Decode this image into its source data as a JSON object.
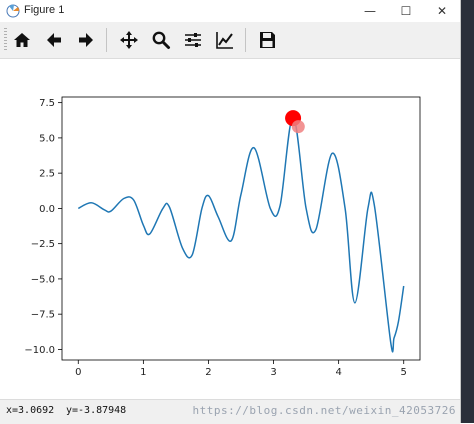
{
  "window": {
    "title": "Figure 1",
    "minimize_symbol": "—",
    "maximize_symbol": "☐",
    "close_symbol": "✕"
  },
  "toolbar": {
    "buttons": [
      {
        "name": "home-button",
        "icon": "home-icon"
      },
      {
        "name": "back-button",
        "icon": "arrow-left-icon"
      },
      {
        "name": "forward-button",
        "icon": "arrow-right-icon"
      },
      {
        "name": "pan-button",
        "icon": "move-icon"
      },
      {
        "name": "zoom-button",
        "icon": "magnifier-icon"
      },
      {
        "name": "configure-subplots-button",
        "icon": "sliders-icon"
      },
      {
        "name": "edit-axes-button",
        "icon": "line-chart-icon"
      },
      {
        "name": "save-button",
        "icon": "floppy-disk-icon"
      }
    ]
  },
  "status": {
    "x_readout": "x=3.0692",
    "y_readout": "y=-3.87948"
  },
  "watermark": "https://blog.csdn.net/weixin_42053726",
  "colors": {
    "line": "#1f77b4",
    "marker_main": "#ff0000",
    "marker_secondary": "#f08080"
  },
  "chart_data": {
    "type": "line",
    "title": "",
    "xlabel": "",
    "ylabel": "",
    "xlim": [
      -0.25,
      5.25
    ],
    "ylim": [
      -10.75,
      7.9
    ],
    "xticks": [
      0,
      1,
      2,
      3,
      4,
      5
    ],
    "xtick_labels": [
      "0",
      "1",
      "2",
      "3",
      "4",
      "5"
    ],
    "yticks": [
      7.5,
      5.0,
      2.5,
      0.0,
      -2.5,
      -5.0,
      -7.5,
      -10.0
    ],
    "ytick_labels": [
      "7.5",
      "5.0",
      "2.5",
      "0.0",
      "−2.5",
      "−5.0",
      "−7.5",
      "−10.0"
    ],
    "grid": false,
    "series": [
      {
        "x": [
          0,
          0.2,
          0.4,
          0.5,
          0.7,
          0.85,
          1.0,
          1.1,
          1.3,
          1.4,
          1.6,
          1.75,
          1.9,
          2.0,
          2.15,
          2.35,
          2.5,
          2.7,
          2.95,
          3.1,
          3.3,
          3.5,
          3.65,
          3.9,
          4.1,
          4.25,
          4.45,
          4.55,
          4.8,
          4.85,
          4.92,
          5.0
        ],
        "y": [
          0.0,
          0.4,
          -0.1,
          -0.2,
          0.7,
          0.6,
          -1.2,
          -1.8,
          0.0,
          0.1,
          -2.8,
          -3.3,
          0.0,
          0.9,
          -0.6,
          -2.3,
          1.0,
          4.3,
          0.0,
          0.2,
          6.5,
          0.0,
          -1.5,
          3.9,
          0.0,
          -6.7,
          0.0,
          0.2,
          -9.5,
          -9.2,
          -8.0,
          -5.5
        ]
      }
    ],
    "markers": [
      {
        "x": 3.3,
        "y": 6.4,
        "style": "main"
      },
      {
        "x": 3.38,
        "y": 5.8,
        "style": "secondary"
      }
    ]
  }
}
